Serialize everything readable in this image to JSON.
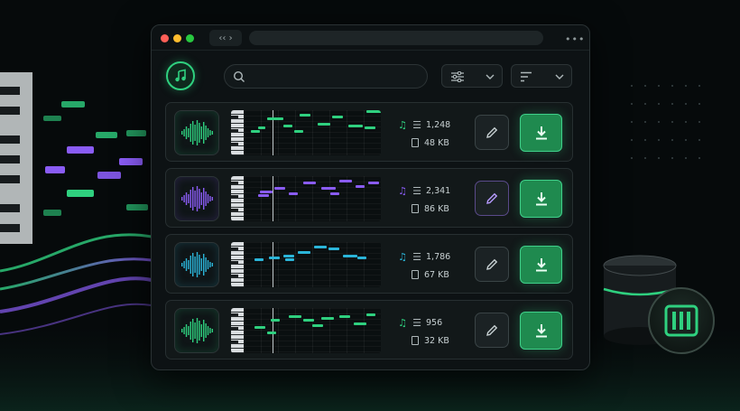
{
  "window": {
    "nav_label": "‹‹  ›"
  },
  "colors": {
    "accent": "#2fd07f",
    "purple": "#8a5cf5",
    "cyan": "#2bb5d9"
  },
  "toolbar": {
    "search_icon": "search-icon",
    "filter_icon": "sliders-icon",
    "sort_icon": "sort-icon"
  },
  "tracks": [
    {
      "notes_count": "1,248",
      "size": "48 KB",
      "color": "#2fd07f"
    },
    {
      "notes_count": "2,341",
      "size": "86 KB",
      "color": "#8a5cf5"
    },
    {
      "notes_count": "1,786",
      "size": "67 KB",
      "color": "#2bb5d9"
    },
    {
      "notes_count": "956",
      "size": "32 KB",
      "color": "#2fd07f"
    }
  ]
}
